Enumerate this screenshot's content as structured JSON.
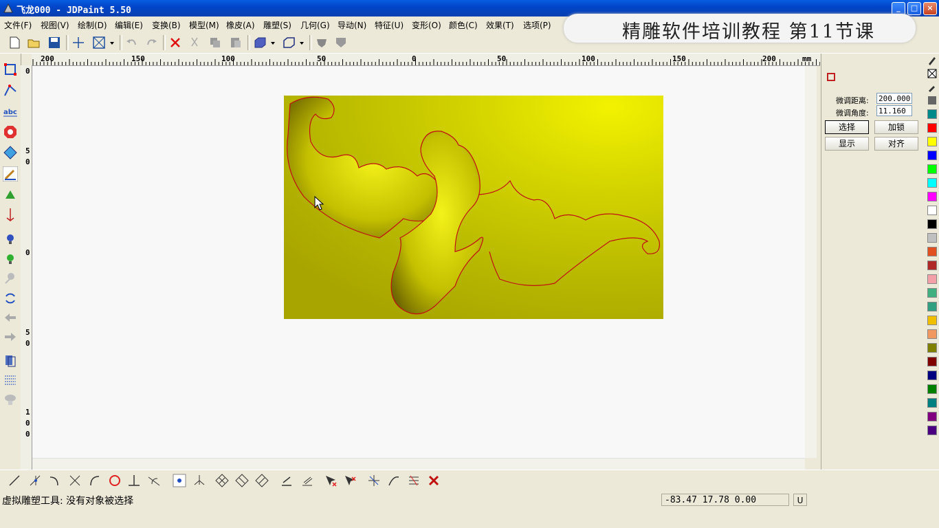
{
  "window": {
    "title": "飞龙000 - JDPaint 5.50",
    "controls": {
      "minimize": "_",
      "maximize": "□",
      "close": "×"
    }
  },
  "banner": {
    "text": "精雕软件培训教程  第11节课"
  },
  "menu": {
    "items": [
      "文件(F)",
      "视图(V)",
      "绘制(D)",
      "编辑(E)",
      "变换(B)",
      "模型(M)",
      "橡皮(A)",
      "雕塑(S)",
      "几何(G)",
      "导动(N)",
      "特征(U)",
      "变形(O)",
      "颜色(C)",
      "效果(T)",
      "选项(P)"
    ]
  },
  "ruler": {
    "labels": [
      "200",
      "150",
      "100",
      "50",
      "0",
      "50",
      "100",
      "150",
      "200"
    ],
    "unit": "mm",
    "vertical_labels": [
      "0",
      "5",
      "0",
      "0",
      "5",
      "0",
      "1",
      "0",
      "0"
    ]
  },
  "panel": {
    "distance_label": "微调距离:",
    "distance_value": "200.000",
    "angle_label": "微调角度:",
    "angle_value": "11.160",
    "buttons": {
      "select": "选择",
      "lock": "加锁",
      "show": "显示",
      "align": "对齐"
    }
  },
  "palette": {
    "colors": [
      "#008b8b",
      "#ff0000",
      "#ffff00",
      "#0000ff",
      "#00ff00",
      "#00ffff",
      "#ff00ff",
      "#ffffff",
      "#000000",
      "#c0c0c0",
      "#e05020",
      "#b02828",
      "#f4a0a8",
      "#40b080",
      "#30a080",
      "#f0c000",
      "#f09860",
      "#808000",
      "#800000",
      "#000080",
      "#008000",
      "#008080",
      "#800080",
      "#4b0082"
    ]
  },
  "status": {
    "message": "虚拟雕塑工具: 没有对象被选择",
    "coordinates": "-83.47 17.78 0.00",
    "unit_button": "U"
  },
  "colors": {
    "accent": "#0a5de0",
    "model_surface": "#d4d400",
    "model_outline": "#c01010"
  }
}
